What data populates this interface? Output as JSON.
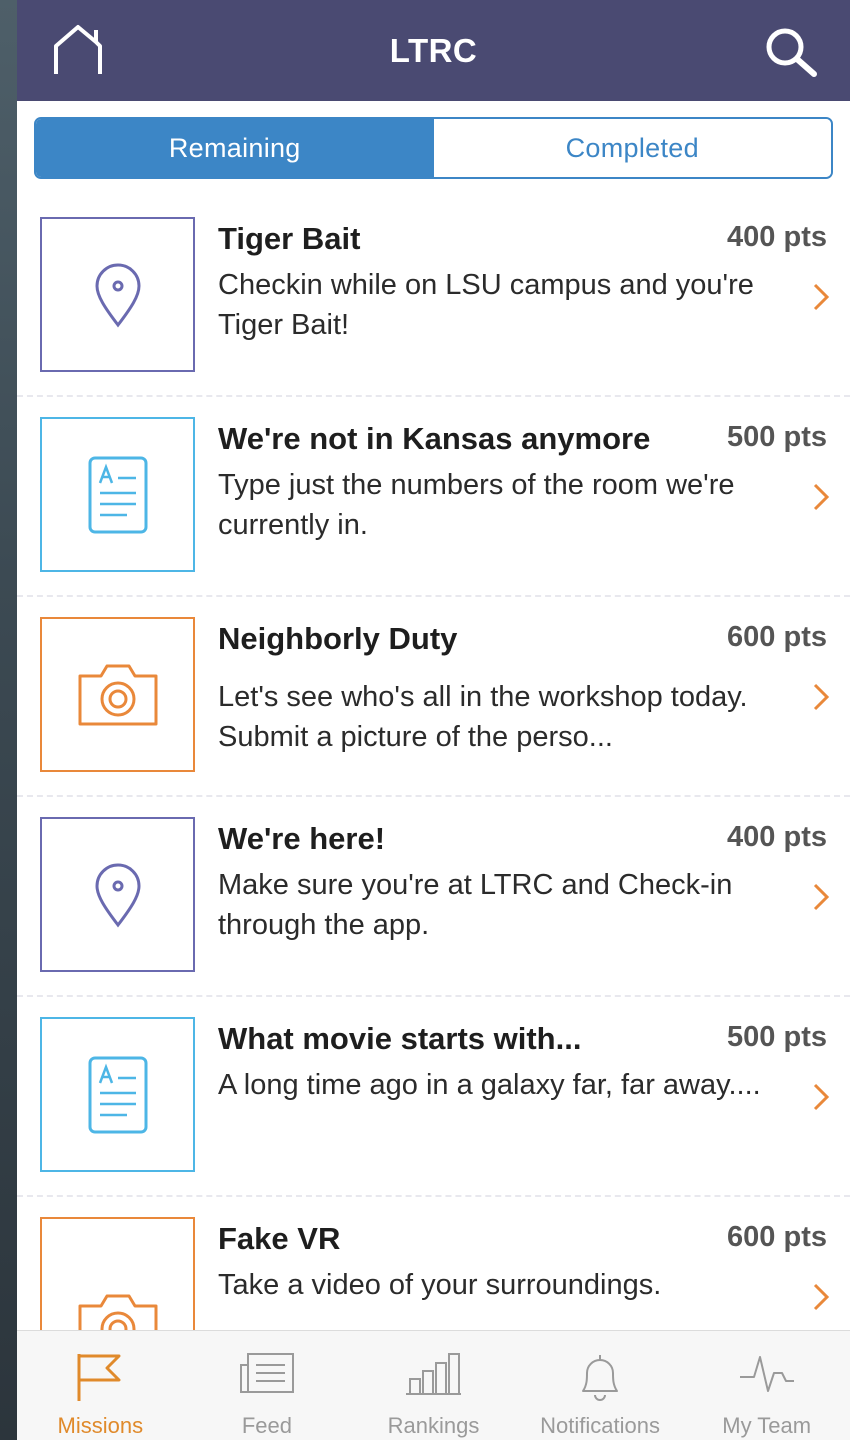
{
  "header": {
    "title": "LTRC"
  },
  "segments": {
    "remaining": "Remaining",
    "completed": "Completed"
  },
  "missions": [
    {
      "title": "Tiger Bait",
      "points": "400 pts",
      "description": "Checkin while on LSU campus and you're Tiger Bait!",
      "icon": "location-pin-icon",
      "color": "#6a6ab0"
    },
    {
      "title": "We're not in Kansas anymore",
      "points": "500 pts",
      "description": "Type just the numbers of the room we're currently in.",
      "icon": "text-document-icon",
      "color": "#4db6e6"
    },
    {
      "title": "Neighborly Duty",
      "points": "600 pts",
      "description": "Let's see who's all in the workshop today.  Submit a picture of the perso...",
      "icon": "camera-icon",
      "color": "#e9883a"
    },
    {
      "title": "We're here!",
      "points": "400 pts",
      "description": "Make sure you're at LTRC and Check-in through the app.",
      "icon": "location-pin-icon",
      "color": "#6a6ab0"
    },
    {
      "title": "What movie starts with...",
      "points": "500 pts",
      "description": "A long time ago in a galaxy far, far away....",
      "icon": "text-document-icon",
      "color": "#4db6e6"
    },
    {
      "title": "Fake VR",
      "points": "600 pts",
      "description": "Take a video of your surroundings.",
      "icon": "camera-icon",
      "color": "#e9883a"
    }
  ],
  "tabs": {
    "missions": "Missions",
    "feed": "Feed",
    "rankings": "Rankings",
    "notifications": "Notifications",
    "my_team": "My Team"
  },
  "colors": {
    "header": "#4a4a72",
    "accent": "#3c86c6",
    "active_tab": "#e08a2b",
    "chevron": "#e9883a"
  }
}
